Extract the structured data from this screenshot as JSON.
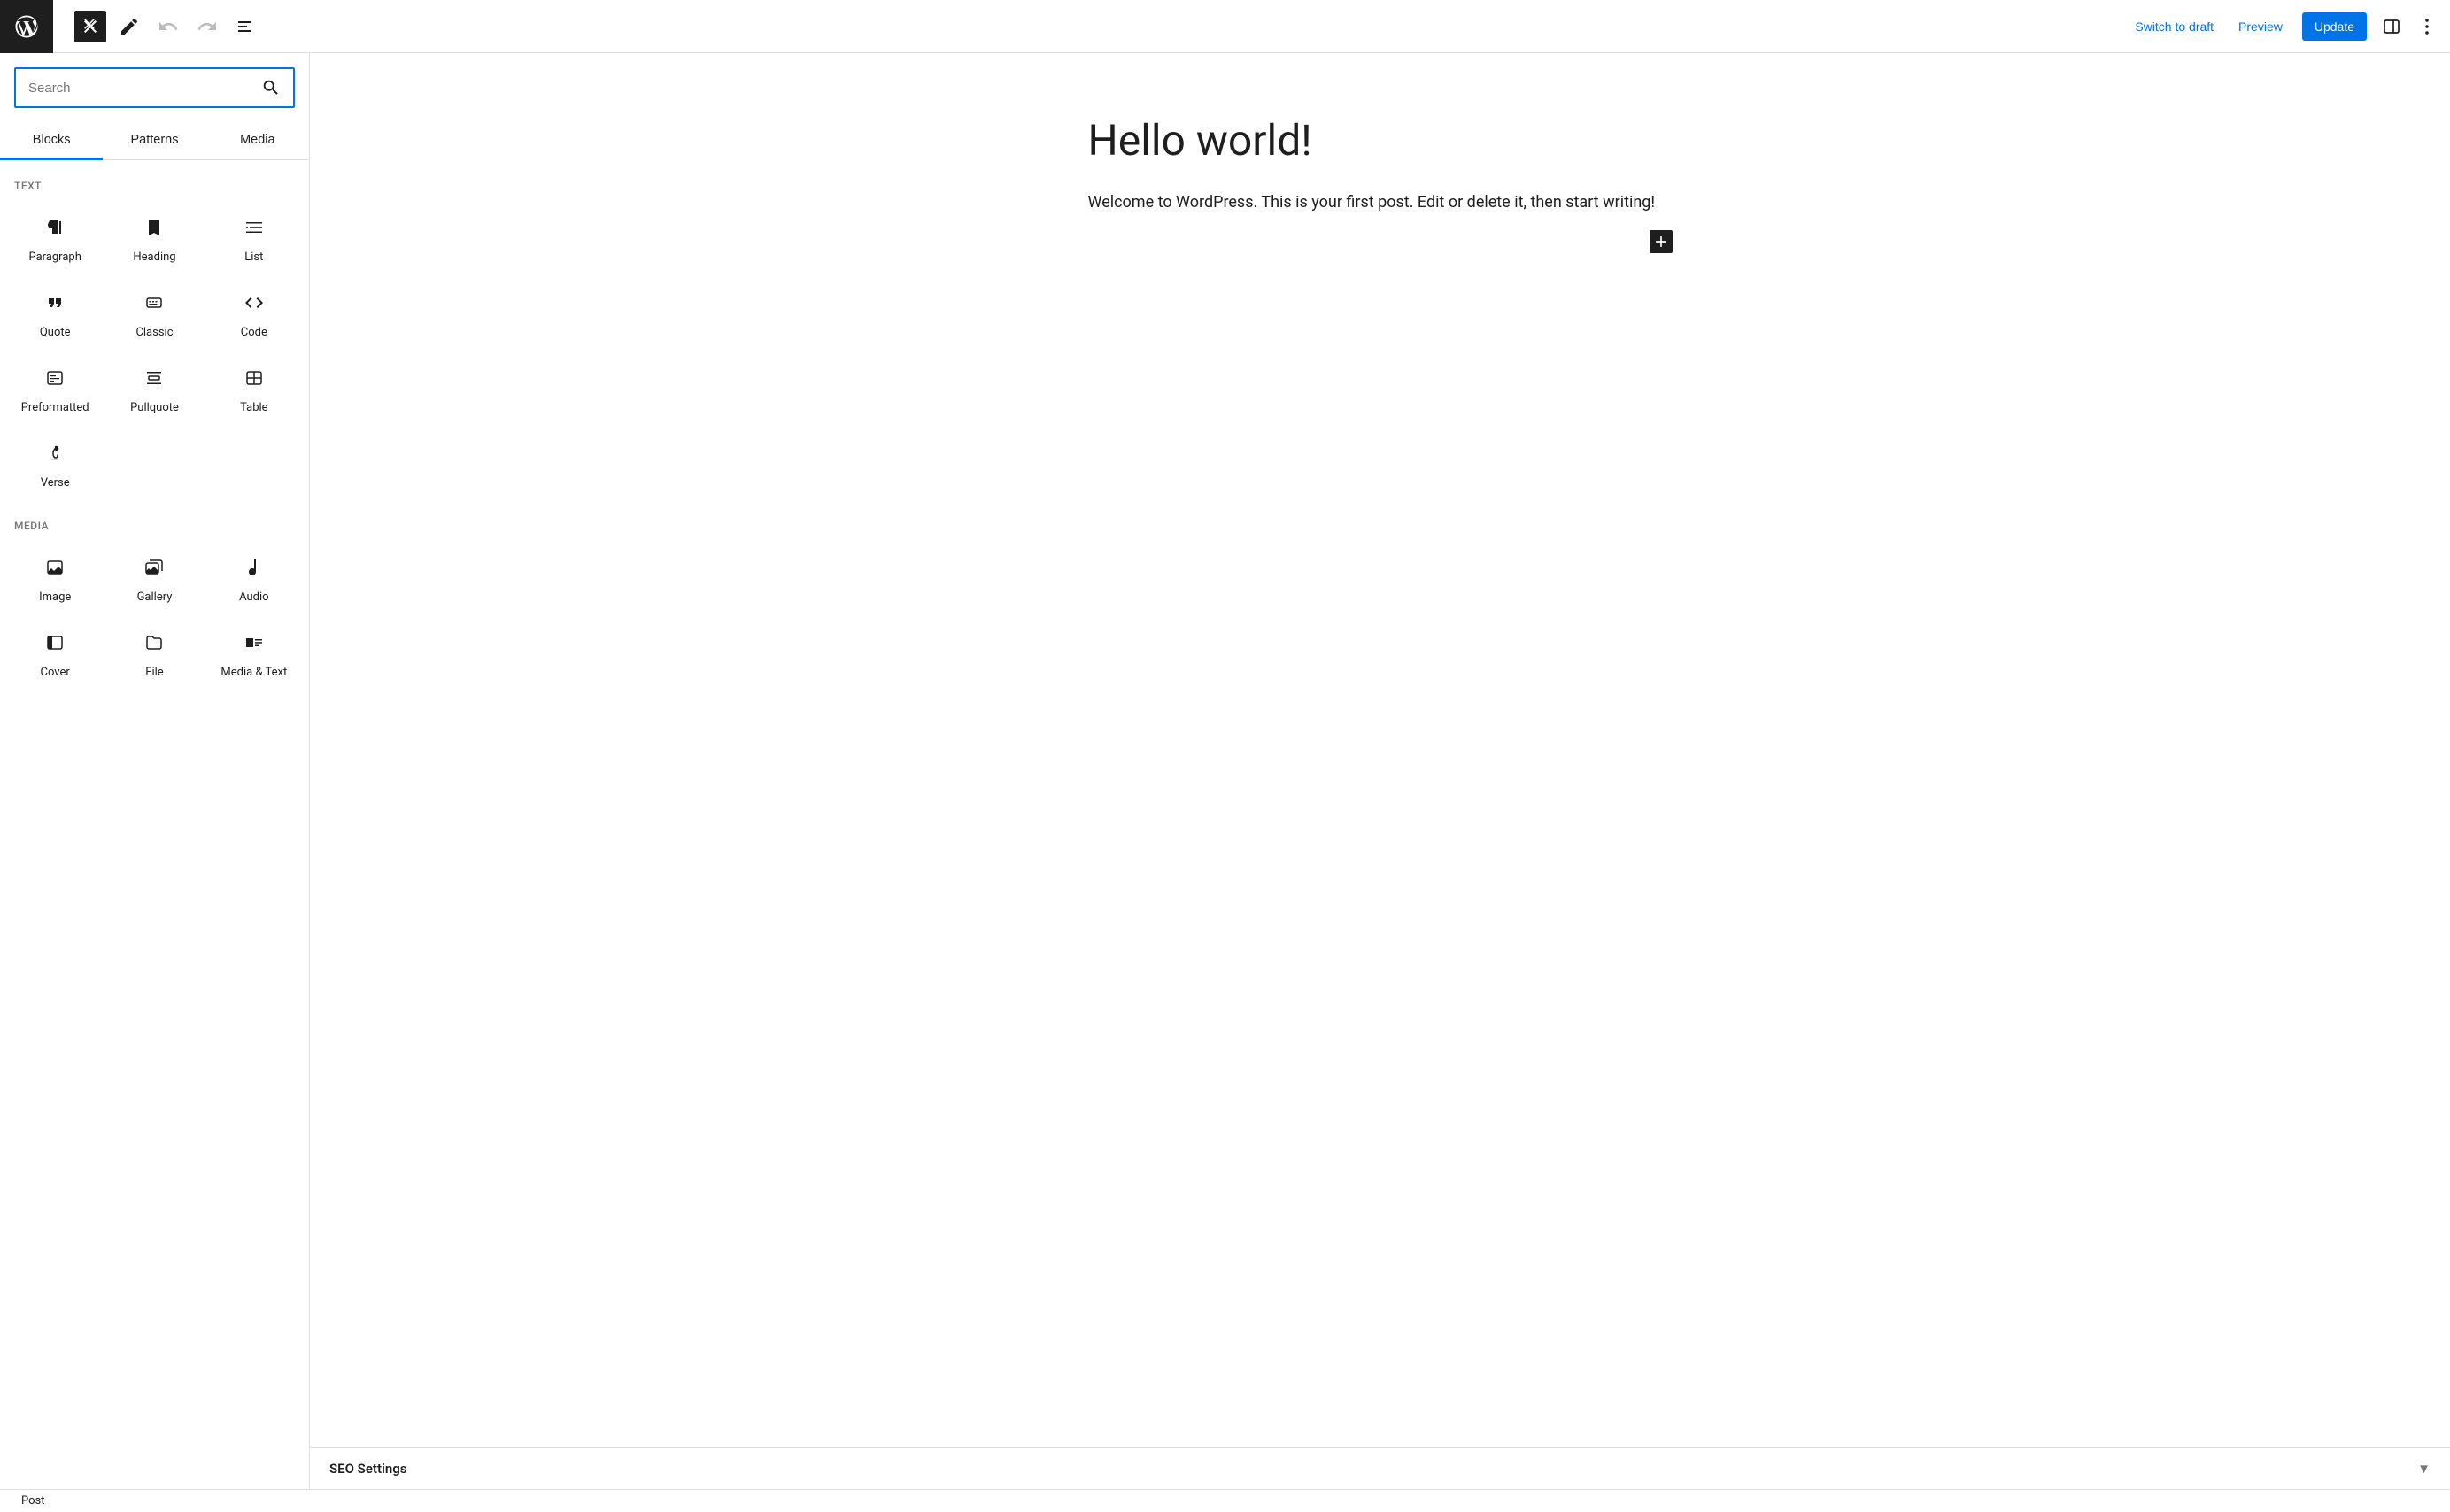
{
  "toolbar": {
    "switch_draft": "Switch to draft",
    "preview": "Preview",
    "update": "Update"
  },
  "inserter": {
    "search_placeholder": "Search",
    "tabs": {
      "blocks": "Blocks",
      "patterns": "Patterns",
      "media": "Media"
    },
    "categories": {
      "text": {
        "label": "TEXT",
        "items": {
          "paragraph": "Paragraph",
          "heading": "Heading",
          "list": "List",
          "quote": "Quote",
          "classic": "Classic",
          "code": "Code",
          "preformatted": "Preformatted",
          "pullquote": "Pullquote",
          "table": "Table",
          "verse": "Verse"
        }
      },
      "media": {
        "label": "MEDIA",
        "items": {
          "image": "Image",
          "gallery": "Gallery",
          "audio": "Audio",
          "cover": "Cover",
          "file": "File",
          "media_text": "Media & Text"
        }
      }
    }
  },
  "post": {
    "title": "Hello world!",
    "body": "Welcome to WordPress. This is your first post. Edit or delete it, then start writing!"
  },
  "seo_panel": {
    "title": "SEO Settings"
  },
  "footer": {
    "breadcrumb": "Post"
  }
}
